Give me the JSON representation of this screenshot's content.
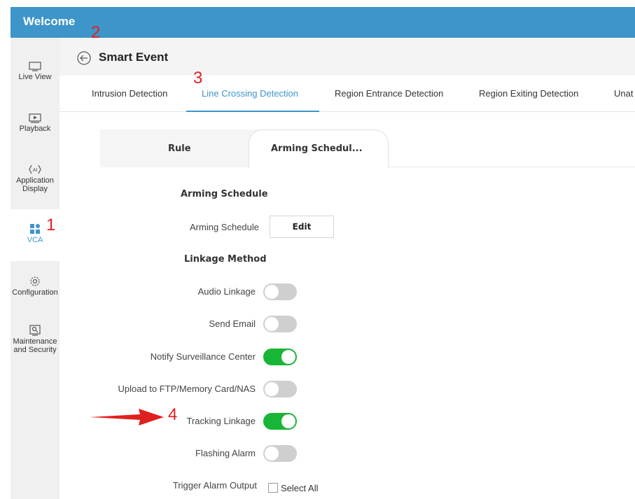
{
  "topbar": {
    "title": "Welcome"
  },
  "sidebar": {
    "items": [
      {
        "label": "Live View",
        "icon": "monitor-icon"
      },
      {
        "label": "Playback",
        "icon": "playback-icon"
      },
      {
        "label": "Application Display",
        "icon": "ai-icon"
      },
      {
        "label": "VCA",
        "icon": "grid-icon"
      },
      {
        "label": "Configuration",
        "icon": "gear-icon"
      },
      {
        "label": "Maintenance and Security",
        "icon": "wrench-icon"
      }
    ]
  },
  "header": {
    "title": "Smart Event"
  },
  "tabs": [
    {
      "label": "Intrusion Detection"
    },
    {
      "label": "Line Crossing Detection",
      "active": true
    },
    {
      "label": "Region Entrance Detection"
    },
    {
      "label": "Region Exiting Detection"
    },
    {
      "label": "Unat"
    }
  ],
  "subtabs": {
    "rule": "Rule",
    "arming": "Arming Schedul..."
  },
  "form": {
    "arming_section": "Arming Schedule",
    "arming_label": "Arming Schedule",
    "edit_button": "Edit",
    "linkage_section": "Linkage Method",
    "toggles": [
      {
        "label": "Audio Linkage",
        "on": false
      },
      {
        "label": "Send Email",
        "on": false
      },
      {
        "label": "Notify Surveillance Center",
        "on": true
      },
      {
        "label": "Upload to FTP/Memory Card/NAS",
        "on": false
      },
      {
        "label": "Tracking Linkage",
        "on": true
      },
      {
        "label": "Flashing Alarm",
        "on": false
      }
    ],
    "trigger_label": "Trigger Alarm Output",
    "select_all": "Select All"
  },
  "annotations": {
    "a1": "1",
    "a2": "2",
    "a3": "3",
    "a4": "4"
  },
  "colors": {
    "accent": "#3d95c9",
    "toggle_on": "#19b536",
    "annotation": "#e0201e"
  }
}
